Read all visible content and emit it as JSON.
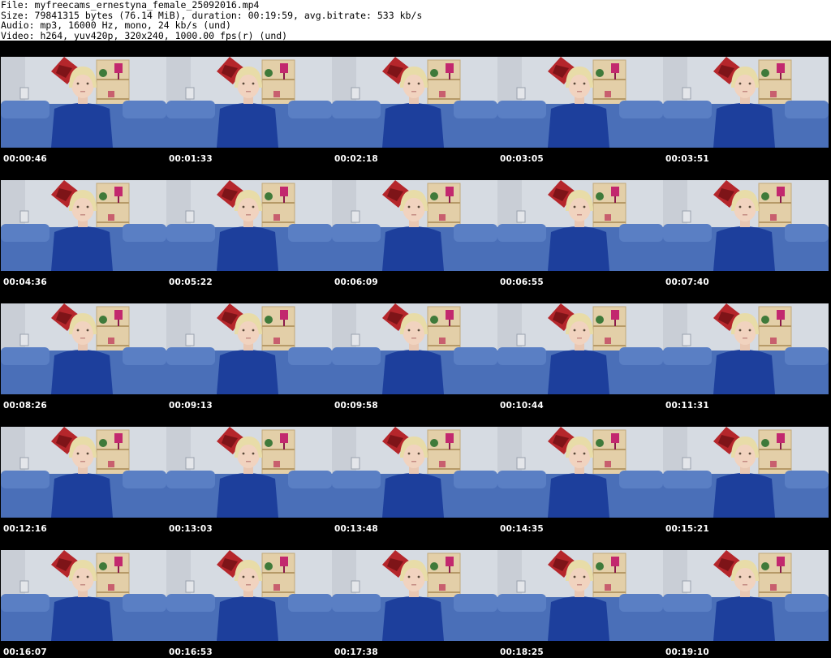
{
  "header": {
    "file_line": "File: myfreecams_ernestyna_female_25092016.mp4",
    "size_line": "Size: 79841315 bytes (76.14 MiB), duration: 00:19:59, avg.bitrate: 533 kb/s",
    "audio_line": "Audio: mp3, 16000 Hz, mono, 24 kb/s (und)",
    "video_line": "Video: h264, yuv420p, 320x240, 1000.00 fps(r) (und)"
  },
  "colors": {
    "sheet_background": "#000000",
    "wall": "#d9dde3",
    "sofa": "#4a6fb8",
    "shirt": "#1d3f9c",
    "hair": "#e8dca8",
    "poster": "#b5262b",
    "lamp": "#c2286e"
  },
  "thumbnails": [
    {
      "time": "00:00:46"
    },
    {
      "time": "00:01:33"
    },
    {
      "time": "00:02:18"
    },
    {
      "time": "00:03:05"
    },
    {
      "time": "00:03:51"
    },
    {
      "time": "00:04:36"
    },
    {
      "time": "00:05:22"
    },
    {
      "time": "00:06:09"
    },
    {
      "time": "00:06:55"
    },
    {
      "time": "00:07:40"
    },
    {
      "time": "00:08:26"
    },
    {
      "time": "00:09:13"
    },
    {
      "time": "00:09:58"
    },
    {
      "time": "00:10:44"
    },
    {
      "time": "00:11:31"
    },
    {
      "time": "00:12:16"
    },
    {
      "time": "00:13:03"
    },
    {
      "time": "00:13:48"
    },
    {
      "time": "00:14:35"
    },
    {
      "time": "00:15:21"
    },
    {
      "time": "00:16:07"
    },
    {
      "time": "00:16:53"
    },
    {
      "time": "00:17:38"
    },
    {
      "time": "00:18:25"
    },
    {
      "time": "00:19:10"
    }
  ]
}
